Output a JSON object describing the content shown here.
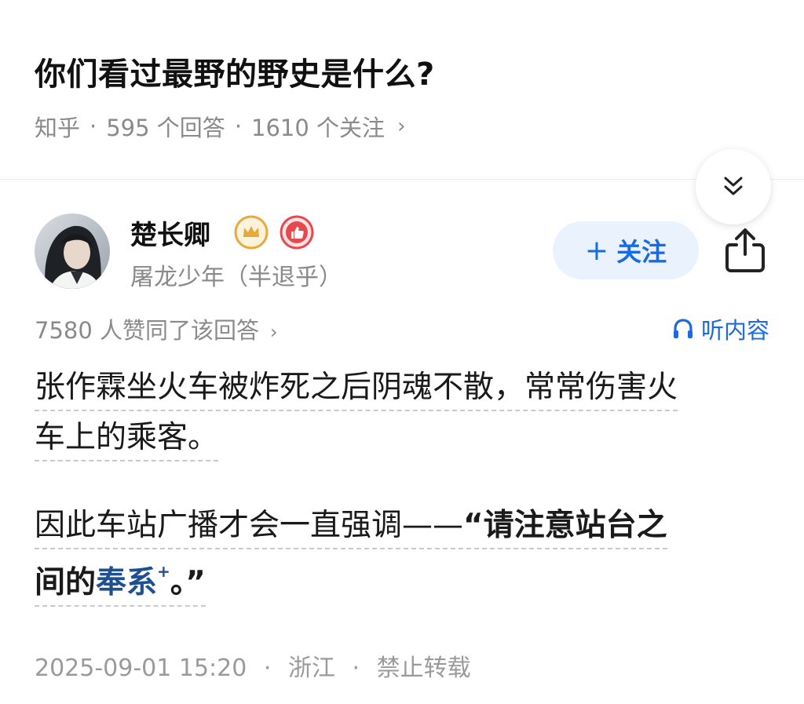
{
  "question": {
    "title": "你们看过最野的野史是什么?",
    "source": "知乎",
    "answers": "595 个回答",
    "followers": "1610 个关注",
    "chevron": "›"
  },
  "author": {
    "name": "楚长卿",
    "bio": "屠龙少年（半退乎）",
    "follow_label": "关注",
    "follow_icon": "+"
  },
  "answer": {
    "agree_text": "7580 人赞同了该回答",
    "agree_chevron": "›",
    "listen_label": "听内容",
    "p1_line1": "张作霖坐火车被炸死之后阴魂不散，常常伤害火",
    "p1_line2": "车上的乘客。",
    "p2_normal": "因此车站广播才会一直强调——",
    "p2_bold1": "“请注意站台之",
    "p2_bold2": "间的",
    "p2_link": "奉系",
    "p2_link_mark": "+",
    "p2_bold3": "。”",
    "timestamp": "2025-09-01 15:20",
    "location": "浙江",
    "rights": "禁止转载",
    "sep": "·"
  },
  "icons": {
    "collapse": "double-chevron-down-icon",
    "share": "share-icon",
    "headphones": "headphones-icon",
    "crown_badge": "crown-badge-icon",
    "like_badge": "thumbs-up-badge-icon"
  },
  "colors": {
    "accent_blue": "#1a6be0",
    "link_blue": "#1d4f91",
    "follow_bg": "#eaf2fe",
    "muted_text": "#8a8a8a",
    "badge_gold": "#e8a93a",
    "badge_red": "#e5484d"
  }
}
